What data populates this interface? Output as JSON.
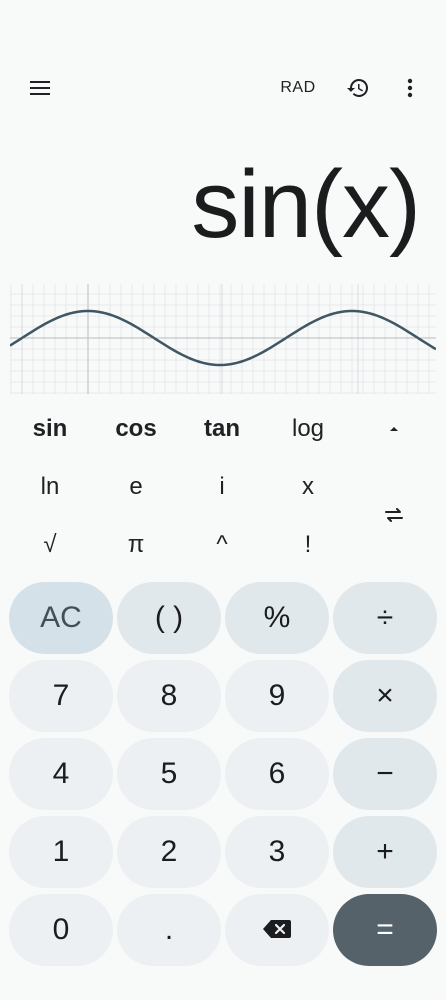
{
  "toolbar": {
    "menu_icon": "menu-icon",
    "angle_mode": "RAD",
    "history_icon": "history-icon",
    "more_icon": "more-vert-icon"
  },
  "display": {
    "expression": "sin(x)"
  },
  "graph": {
    "function": "sin(x)",
    "line_color": "#3f5663"
  },
  "scientific": {
    "row1": [
      "sin",
      "cos",
      "tan",
      "log"
    ],
    "row2": [
      "ln",
      "e",
      "i",
      "x"
    ],
    "row3": [
      "√",
      "π",
      "^",
      "!"
    ],
    "collapse_icon": "caret-up-icon",
    "swap_icon": "swap-icon"
  },
  "keypad": {
    "ac": "AC",
    "paren": "( )",
    "percent": "%",
    "divide": "÷",
    "seven": "7",
    "eight": "8",
    "nine": "9",
    "multiply": "×",
    "four": "4",
    "five": "5",
    "six": "6",
    "minus": "−",
    "one": "1",
    "two": "2",
    "three": "3",
    "plus": "+",
    "zero": "0",
    "dot": ".",
    "backspace_icon": "backspace-icon",
    "equals": "="
  },
  "colors": {
    "background": "#f8f9f9",
    "key": "#edf0f2",
    "operator_key": "#e1e8ec",
    "ac_key": "#d5e1e8",
    "equals_key": "#55626a"
  }
}
